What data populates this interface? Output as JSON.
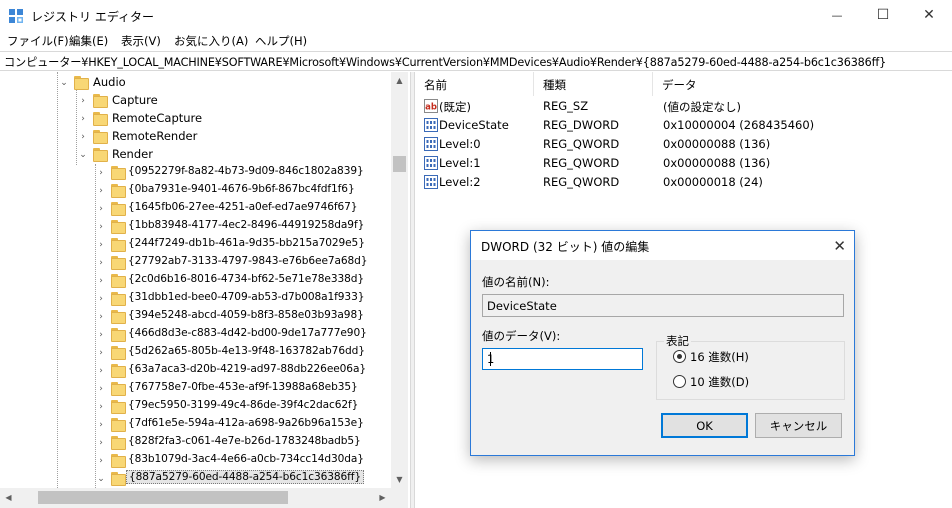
{
  "window": {
    "title": "レジストリ エディター",
    "minimize_glyph": "—",
    "maximize_glyph": "☐",
    "close_glyph": "✕"
  },
  "menu": [
    "ファイル(F)",
    "編集(E)",
    "表示(V)",
    "お気に入り(A)",
    "ヘルプ(H)"
  ],
  "address": "コンピューター¥HKEY_LOCAL_MACHINE¥SOFTWARE¥Microsoft¥Windows¥CurrentVersion¥MMDevices¥Audio¥Render¥{887a5279-60ed-4488-a254-b6c1c36386ff}",
  "tree": {
    "audio": "Audio",
    "audio_children": [
      "Capture",
      "RemoteCapture",
      "RemoteRender",
      "Render"
    ],
    "render_keys": [
      "{0952279f-8a82-4b73-9d09-846c1802a839}",
      "{0ba7931e-9401-4676-9b6f-867bc4fdf1f6}",
      "{1645fb06-27ee-4251-a0ef-ed7ae9746f67}",
      "{1bb83948-4177-4ec2-8496-44919258da9f}",
      "{244f7249-db1b-461a-9d35-bb215a7029e5}",
      "{27792ab7-3133-4797-9843-e76b6ee7a68d}",
      "{2c0d6b16-8016-4734-bf62-5e71e78e338d}",
      "{31dbb1ed-bee0-4709-ab53-d7b008a1f933}",
      "{394e5248-abcd-4059-b8f3-858e03b93a98}",
      "{466d8d3e-c883-4d42-bd00-9de17a777e90}",
      "{5d262a65-805b-4e13-9f48-163782ab76dd}",
      "{63a7aca3-d20b-4219-ad97-88db226ee06a}",
      "{767758e7-0fbe-453e-af9f-13988a68eb35}",
      "{79ec5950-3199-49c4-86de-39f4c2dac62f}",
      "{7df61e5e-594a-412a-a698-9a26b96a153e}",
      "{828f2fa3-c061-4e7e-b26d-1783248badb5}",
      "{83b1079d-3ac4-4e66-a0cb-734cc14d30da}",
      "{887a5279-60ed-4488-a254-b6c1c36386ff}"
    ]
  },
  "list": {
    "headers": [
      "名前",
      "種類",
      "データ"
    ],
    "rows": [
      {
        "icon": "string-value-icon",
        "icon_text": "ab",
        "name": "(既定)",
        "type": "REG_SZ",
        "data": "(値の設定なし)"
      },
      {
        "icon": "binary-value-icon",
        "icon_text": "",
        "name": "DeviceState",
        "type": "REG_DWORD",
        "data": "0x10000004 (268435460)"
      },
      {
        "icon": "binary-value-icon",
        "icon_text": "",
        "name": "Level:0",
        "type": "REG_QWORD",
        "data": "0x00000088 (136)"
      },
      {
        "icon": "binary-value-icon",
        "icon_text": "",
        "name": "Level:1",
        "type": "REG_QWORD",
        "data": "0x00000088 (136)"
      },
      {
        "icon": "binary-value-icon",
        "icon_text": "",
        "name": "Level:2",
        "type": "REG_QWORD",
        "data": "0x00000018 (24)"
      }
    ]
  },
  "dialog": {
    "title": "DWORD (32 ビット) 値の編集",
    "close_glyph": "✕",
    "name_label": "値の名前(N):",
    "name_value": "DeviceState",
    "data_label": "値のデータ(V):",
    "data_value": "1",
    "base_label": "表記",
    "radio_hex": "16 進数(H)",
    "radio_dec": "10 進数(D)",
    "ok": "OK",
    "cancel": "キャンセル"
  },
  "colors": {
    "accent": "#0078d7",
    "folder": "#f8d775",
    "dialog_border": "#2b79d8"
  }
}
